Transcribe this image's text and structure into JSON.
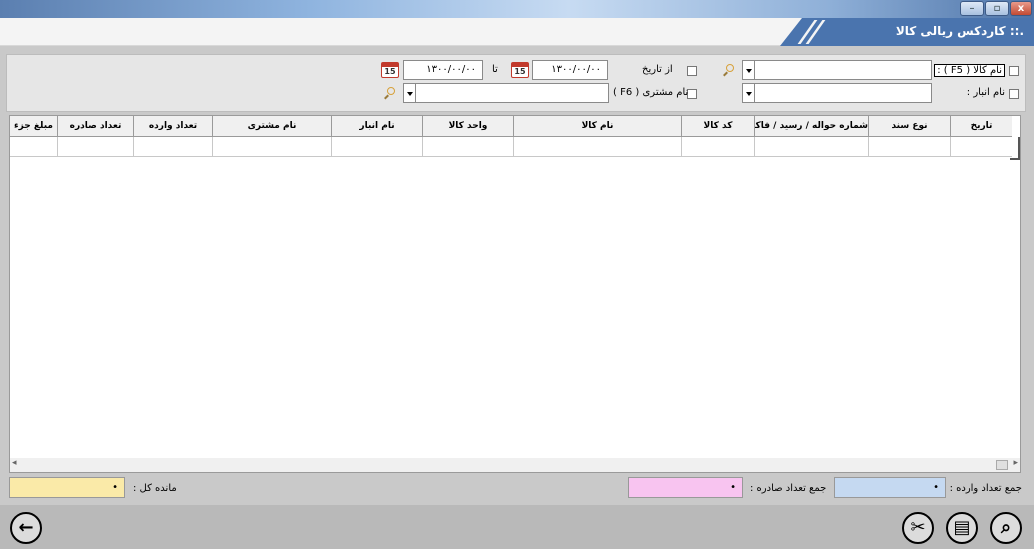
{
  "window": {
    "title": ".:: کاردکس ریالی کالا",
    "controls": {
      "minimize": "–",
      "maximize": "▫",
      "close": "x"
    }
  },
  "filters": {
    "product_name_label": "نام کالا ( F5 ) :",
    "warehouse_label": "نام انبار :",
    "from_date_label": "از تاریخ",
    "to_label": "تا",
    "from_date_value": "۱۳۰۰/۰۰/۰۰",
    "to_date_value": "۱۳۰۰/۰۰/۰۰",
    "customer_label": "نام مشتری ( F6 )",
    "calendar_badge": "15"
  },
  "table": {
    "columns": [
      "تاریخ",
      "نوع سند",
      "شماره حواله / رسید / فاکتور",
      "کد کالا",
      "نام کالا",
      "واحد کالا",
      "نام انبار",
      "نام مشتری",
      "تعداد وارده",
      "تعداد صادره",
      "مبلغ جزء"
    ]
  },
  "totals": {
    "total_in_label": "جمع تعداد وارده :",
    "total_in_value": "•",
    "total_out_label": "جمع تعداد صادره :",
    "total_out_value": "•",
    "balance_label": "مانده کل :",
    "balance_value": "•"
  },
  "colors": {
    "title_blue": "#4a74ae",
    "total_in_bg": "#c5d9f1",
    "total_out_bg": "#f8c4f0",
    "balance_bg": "#faeaa8"
  }
}
